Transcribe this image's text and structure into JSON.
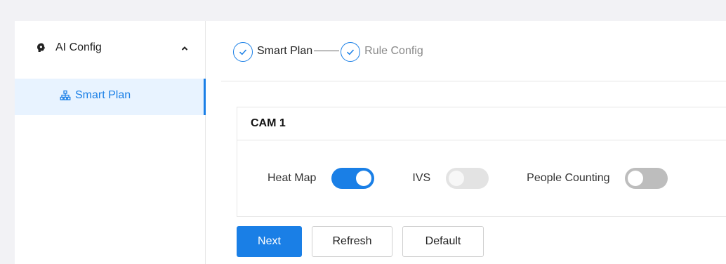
{
  "sidebar": {
    "group": {
      "label": "AI Config",
      "icon": "ai-config-icon",
      "expanded": true
    },
    "items": [
      {
        "label": "Smart Plan",
        "icon": "org-chart-icon",
        "active": true
      }
    ]
  },
  "steps": [
    {
      "label": "Smart Plan",
      "state": "done"
    },
    {
      "label": "Rule Config",
      "state": "current"
    }
  ],
  "card": {
    "title": "CAM 1",
    "toggles": [
      {
        "label": "Heat Map",
        "on": true
      },
      {
        "label": "IVS",
        "on": false,
        "disabled": true
      },
      {
        "label": "People Counting",
        "on": false
      }
    ]
  },
  "buttons": {
    "next": "Next",
    "refresh": "Refresh",
    "default": "Default"
  },
  "colors": {
    "accent": "#1a7fe6",
    "active_bg": "#e8f3ff"
  }
}
